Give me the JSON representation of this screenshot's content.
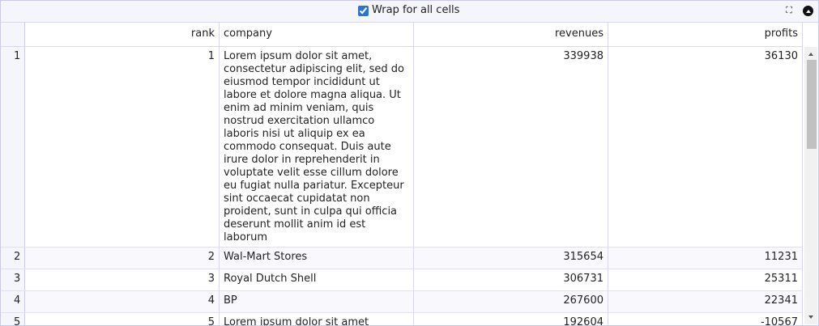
{
  "toolbar": {
    "wrap_label": "Wrap for all cells",
    "wrap_checked": true,
    "expand_icon": "expand-icon",
    "collapse_icon": "collapse-icon"
  },
  "table": {
    "columns": [
      "rank",
      "company",
      "revenues",
      "profits"
    ],
    "rows": [
      {
        "index": "1",
        "rank": "1",
        "company": "Lorem ipsum dolor sit amet, consectetur adipiscing elit, sed do eiusmod tempor incididunt ut labore et dolore magna aliqua. Ut enim ad minim veniam, quis nostrud exercitation ullamco laboris nisi ut aliquip ex ea commodo consequat. Duis aute irure dolor in reprehenderit in voluptate velit esse cillum dolore eu fugiat nulla pariatur. Excepteur sint occaecat cupidatat non proident, sunt in culpa qui officia deserunt mollit anim id est laborum",
        "revenues": "339938",
        "profits": "36130"
      },
      {
        "index": "2",
        "rank": "2",
        "company": "Wal-Mart Stores",
        "revenues": "315654",
        "profits": "11231"
      },
      {
        "index": "3",
        "rank": "3",
        "company": "Royal Dutch Shell",
        "revenues": "306731",
        "profits": "25311"
      },
      {
        "index": "4",
        "rank": "4",
        "company": "BP",
        "revenues": "267600",
        "profits": "22341"
      },
      {
        "index": "5",
        "rank": "5",
        "company": "Lorem ipsum dolor sit amet",
        "revenues": "192604",
        "profits": "-10567"
      }
    ]
  },
  "colors": {
    "border": "#c8c8f0",
    "header_bg": "#f5f5fc",
    "checkbox_accent": "#2a74d8"
  }
}
